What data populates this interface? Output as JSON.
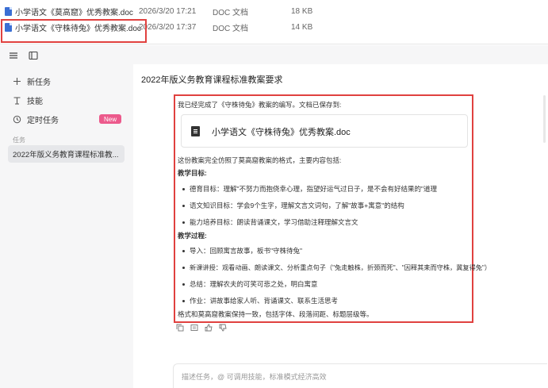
{
  "files": [
    {
      "name": "小学语文《莫高窟》优秀教案.doc",
      "date": "2026/3/20 17:21",
      "type": "DOC 文档",
      "size": "18 KB"
    },
    {
      "name": "小学语文《守株待兔》优秀教案.doc",
      "date": "2026/3/20 17:37",
      "type": "DOC 文档",
      "size": "14 KB"
    }
  ],
  "sidebar": {
    "items": [
      {
        "label": "新任务",
        "icon": "plus-icon"
      },
      {
        "label": "技能",
        "icon": "skill-icon"
      },
      {
        "label": "定时任务",
        "icon": "clock-icon"
      }
    ],
    "badge": "New",
    "section_label": "任务",
    "task": "2022年版义务教育课程标准教..."
  },
  "main": {
    "title": "2022年版义务教育课程标准教案要求",
    "message": {
      "intro": "我已经完成了《守株待兔》教案的编写。文档已保存到:",
      "doc_name": "小学语文《守株待兔》优秀教案.doc",
      "desc": "这份教案完全仿照了莫高窟教案的格式，主要内容包括:",
      "goals_heading": "教学目标:",
      "goals": [
        "德育目标：理解\"不努力而抱侥幸心理，指望好运气过日子，是不会有好结果的\"道理",
        "语文知识目标：学会9个生字，理解文言文词句，了解\"故事+寓意\"的结构",
        "能力培养目标：朗读背诵课文，学习借助注释理解文言文"
      ],
      "process_heading": "教学过程:",
      "process": [
        "导入：回顾寓言故事，板书\"守株待兔\"",
        "新课讲授：观看动画、朗读课文、分析重点句子（\"兔走触株，折颈而死\"、\"因释其耒而守株，冀复得兔\"）",
        "总结：理解农夫的可笑可悲之处，明白寓意",
        "作业：讲故事给家人听、背诵课文、联系生活思考"
      ],
      "closing": "格式和莫高窟教案保持一致，包括字体、段落间距、标题层级等。"
    },
    "input_placeholder": "描述任务，@ 可调用技能，标准模式经济高效"
  },
  "colors": {
    "highlight": "#e0413f",
    "badge": "#ec5a8c",
    "file_icon": "#3b6fd4"
  }
}
